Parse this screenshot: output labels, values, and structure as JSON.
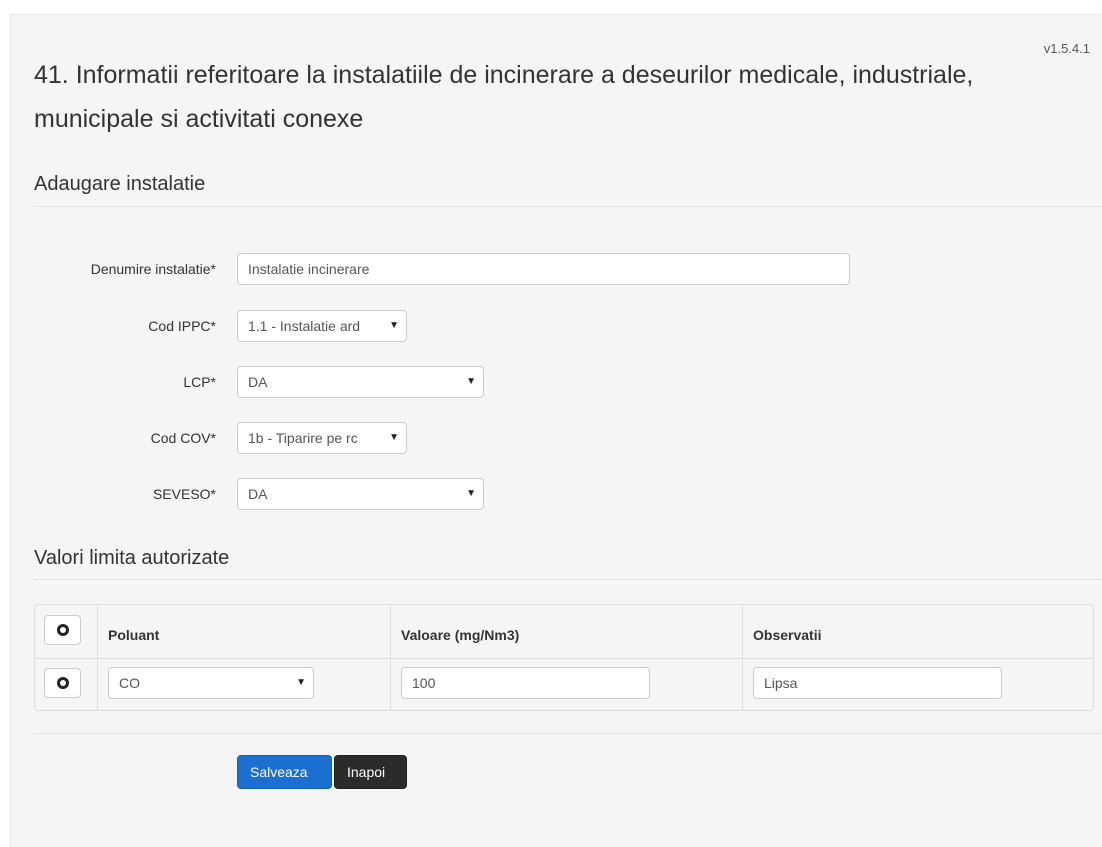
{
  "version": "v1.5.4.1",
  "page_title": "41. Informatii referitoare la instalatiile de incinerare a deseurilor medicale, industriale, municipale si activitati conexe",
  "section_add": "Adaugare instalatie",
  "form": {
    "denumire": {
      "label": "Denumire instalatie*",
      "value": "Instalatie incinerare"
    },
    "cod_ippc": {
      "label": "Cod IPPC*",
      "value": "1.1 - Instalatie ard"
    },
    "lcp": {
      "label": "LCP*",
      "value": "DA"
    },
    "cod_cov": {
      "label": "Cod COV*",
      "value": "1b - Tiparire pe rc"
    },
    "seveso": {
      "label": "SEVESO*",
      "value": "DA"
    }
  },
  "section_limits": "Valori limita autorizate",
  "table": {
    "headers": {
      "poluant": "Poluant",
      "valoare": "Valoare (mg/Nm3)",
      "observatii": "Observatii"
    },
    "rows": [
      {
        "poluant": "CO",
        "valoare": "100",
        "observatii": "Lipsa"
      }
    ]
  },
  "buttons": {
    "save": "Salveaza",
    "back": "Inapoi"
  },
  "colors": {
    "primary": "#1a6fd1",
    "dark": "#2b2b2b",
    "panel": "#f5f5f5"
  }
}
